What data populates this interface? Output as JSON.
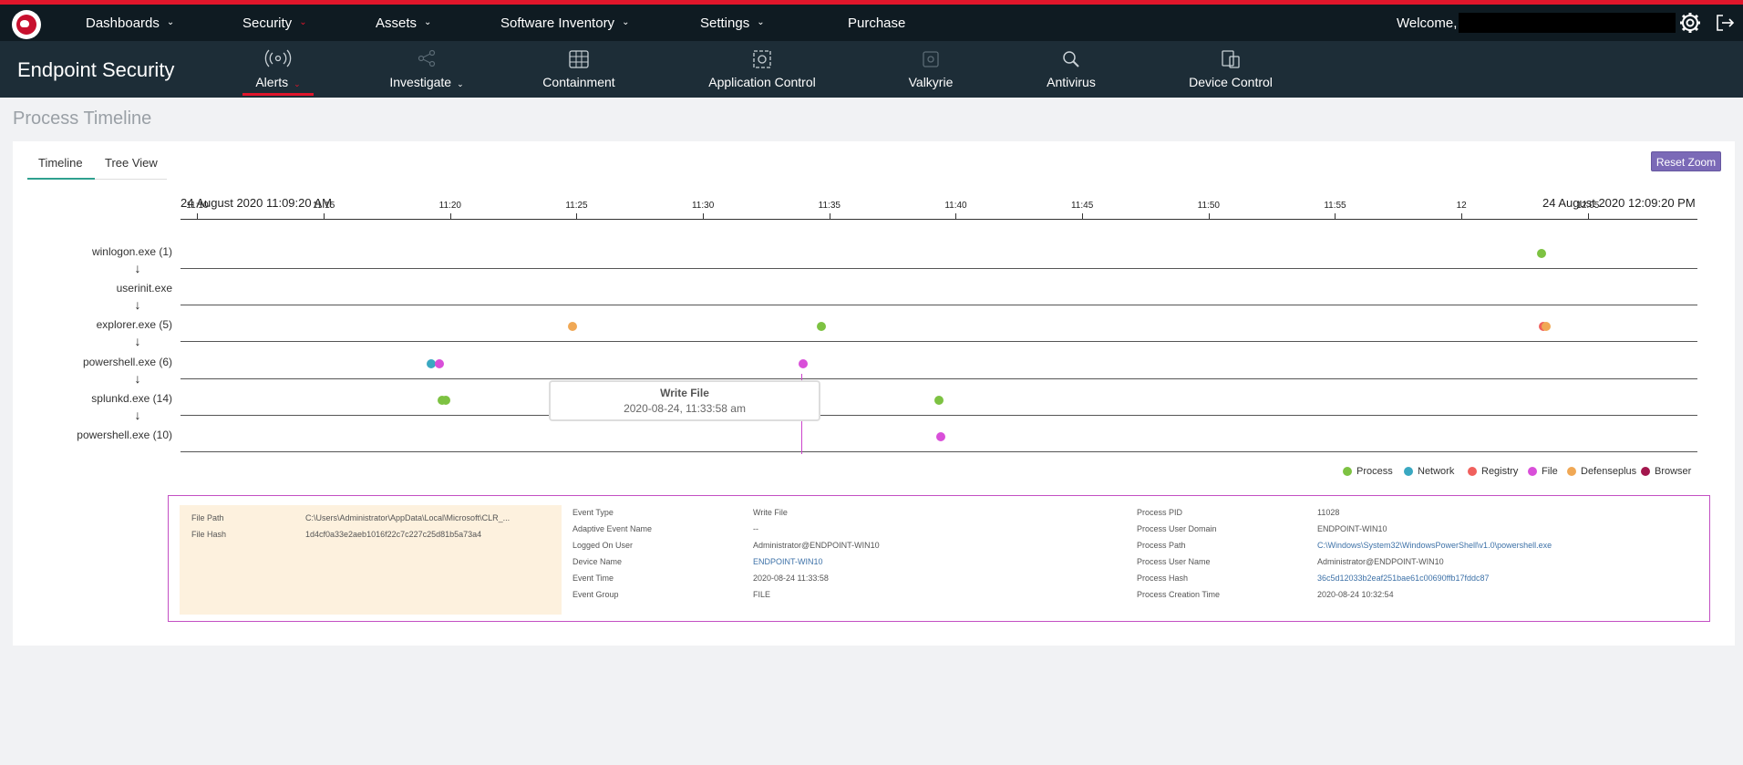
{
  "topnav": {
    "items": [
      {
        "label": "Dashboards",
        "chevron": "chevron-down-icon"
      },
      {
        "label": "Security",
        "chevron": "chevron-down-icon"
      },
      {
        "label": "Assets",
        "chevron": "chevron-down-icon"
      },
      {
        "label": "Software Inventory",
        "chevron": "chevron-down-icon"
      },
      {
        "label": "Settings",
        "chevron": "chevron-down-icon"
      },
      {
        "label": "Purchase"
      }
    ],
    "welcome": "Welcome,",
    "accent_color": "#e0162b"
  },
  "subnav": {
    "brand": "Endpoint Security",
    "items": [
      {
        "label": "Alerts",
        "icon": "signal-icon",
        "active": true
      },
      {
        "label": "Investigate",
        "icon": "share-icon"
      },
      {
        "label": "Containment",
        "icon": "globe-icon"
      },
      {
        "label": "Application Control",
        "icon": "app-control-icon"
      },
      {
        "label": "Valkyrie",
        "icon": "valkyrie-icon"
      },
      {
        "label": "Antivirus",
        "icon": "antivirus-icon"
      },
      {
        "label": "Device Control",
        "icon": "device-icon"
      }
    ]
  },
  "page": {
    "title": "Process Timeline",
    "tabs": [
      "Timeline",
      "Tree View"
    ],
    "reset_zoom": "Reset Zoom"
  },
  "timeline": {
    "start_label": "24 August 2020 11:09:20 AM",
    "end_label": "24 August 2020 12:09:20 PM",
    "ticks": [
      "11:10",
      "11:15",
      "11:20",
      "11:25",
      "11:30",
      "11:35",
      "11:40",
      "11:45",
      "11:50",
      "11:55",
      "12",
      "12:05"
    ],
    "rows": [
      "winlogon.exe (1)",
      "userinit.exe",
      "explorer.exe (5)",
      "powershell.exe (6)",
      "splunkd.exe (14)",
      "powershell.exe (10)"
    ],
    "events": [
      {
        "row": 0,
        "time": "12:03:10",
        "type": "Process"
      },
      {
        "row": 2,
        "time": "11:24:50",
        "type": "Defenseplus"
      },
      {
        "row": 2,
        "time": "11:34:40",
        "type": "Process"
      },
      {
        "row": 2,
        "time": "12:03:15",
        "type": "Registry"
      },
      {
        "row": 2,
        "time": "12:03:20",
        "type": "Defenseplus"
      },
      {
        "row": 3,
        "time": "11:19:15",
        "type": "Network"
      },
      {
        "row": 3,
        "time": "11:19:35",
        "type": "File"
      },
      {
        "row": 3,
        "time": "11:33:58",
        "type": "File"
      },
      {
        "row": 4,
        "time": "11:19:40",
        "type": "Process"
      },
      {
        "row": 4,
        "time": "11:19:50",
        "type": "Process"
      },
      {
        "row": 4,
        "time": "11:39:20",
        "type": "Process"
      },
      {
        "row": 5,
        "time": "11:39:25",
        "type": "File"
      }
    ],
    "tooltip": {
      "title": "Write File",
      "time": "2020-08-24, 11:33:58 am"
    },
    "legend": [
      {
        "name": "Process",
        "color": "#7dc242"
      },
      {
        "name": "Network",
        "color": "#3aa8c1"
      },
      {
        "name": "Registry",
        "color": "#f0605d"
      },
      {
        "name": "File",
        "color": "#d94fd9"
      },
      {
        "name": "Defenseplus",
        "color": "#f0a855"
      },
      {
        "name": "Browser",
        "color": "#a3174d"
      }
    ]
  },
  "details": {
    "file": [
      {
        "key": "File Path",
        "value": "C:\\Users\\Administrator\\AppData\\Local\\Microsoft\\CLR_..."
      },
      {
        "key": "File Hash",
        "value": "1d4cf0a33e2aeb1016f22c7c227c25d81b5a73a4"
      }
    ],
    "event": [
      {
        "key": "Event Type",
        "value": "Write File"
      },
      {
        "key": "Adaptive Event Name",
        "value": "--"
      },
      {
        "key": "Logged On User",
        "value": "Administrator@ENDPOINT-WIN10"
      },
      {
        "key": "Device Name",
        "value": "ENDPOINT-WIN10",
        "link": true
      },
      {
        "key": "Event Time",
        "value": "2020-08-24 11:33:58"
      },
      {
        "key": "Event Group",
        "value": "FILE"
      }
    ],
    "process": [
      {
        "key": "Process PID",
        "value": "11028"
      },
      {
        "key": "Process User Domain",
        "value": "ENDPOINT-WIN10"
      },
      {
        "key": "Process Path",
        "value": "C:\\Windows\\System32\\WindowsPowerShell\\v1.0\\powershell.exe",
        "link": true
      },
      {
        "key": "Process User Name",
        "value": "Administrator@ENDPOINT-WIN10"
      },
      {
        "key": "Process Hash",
        "value": "36c5d12033b2eaf251bae61c00690ffb17fddc87",
        "link": true
      },
      {
        "key": "Process Creation Time",
        "value": "2020-08-24 10:32:54"
      }
    ]
  }
}
